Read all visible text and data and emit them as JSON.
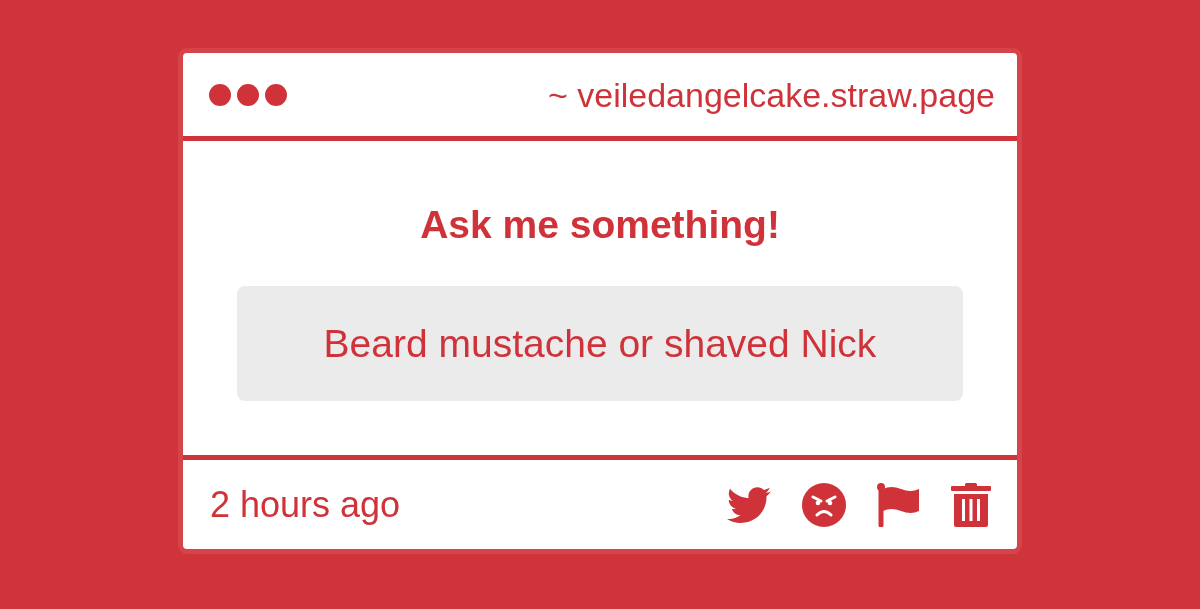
{
  "window": {
    "address": "~ veiledangelcake.straw.page"
  },
  "prompt": {
    "title": "Ask me something!"
  },
  "question": {
    "text": "Beard mustache or shaved Nick"
  },
  "footer": {
    "time": "2 hours ago"
  }
}
